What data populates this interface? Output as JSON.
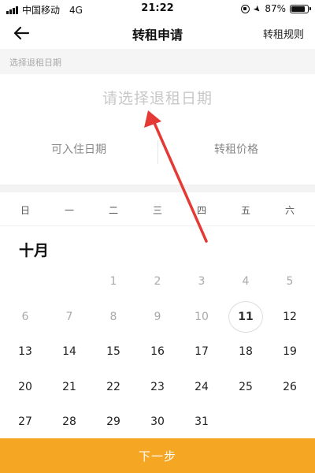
{
  "status_bar": {
    "carrier": "中国移动",
    "network": "4G",
    "time": "21:22",
    "battery": "87%",
    "battery_level": 0.87
  },
  "nav": {
    "title": "转租申请",
    "right_label": "转租规则",
    "back_icon": "back-arrow-icon"
  },
  "section_label": "选择退租日期",
  "date_prompt": "请选择退租日期",
  "info": {
    "checkin_label": "可入住日期",
    "price_label": "转租价格"
  },
  "weekdays": [
    "日",
    "一",
    "二",
    "三",
    "四",
    "五",
    "六"
  ],
  "month_title": "十月",
  "calendar": {
    "rows": [
      [
        "",
        "",
        "1",
        "2",
        "3",
        "4",
        "5"
      ],
      [
        "6",
        "7",
        "8",
        "9",
        "10",
        "11",
        "12"
      ],
      [
        "13",
        "14",
        "15",
        "16",
        "17",
        "18",
        "19"
      ],
      [
        "20",
        "21",
        "22",
        "23",
        "24",
        "25",
        "26"
      ],
      [
        "27",
        "28",
        "29",
        "30",
        "31",
        "",
        ""
      ]
    ],
    "today": "11",
    "past_through": 10
  },
  "next_button": "下一步",
  "colors": {
    "accent": "#f5a623",
    "annotation_arrow": "#e53935",
    "placeholder_text": "#c8c8c8",
    "past_day_text": "#aaaaaa"
  }
}
